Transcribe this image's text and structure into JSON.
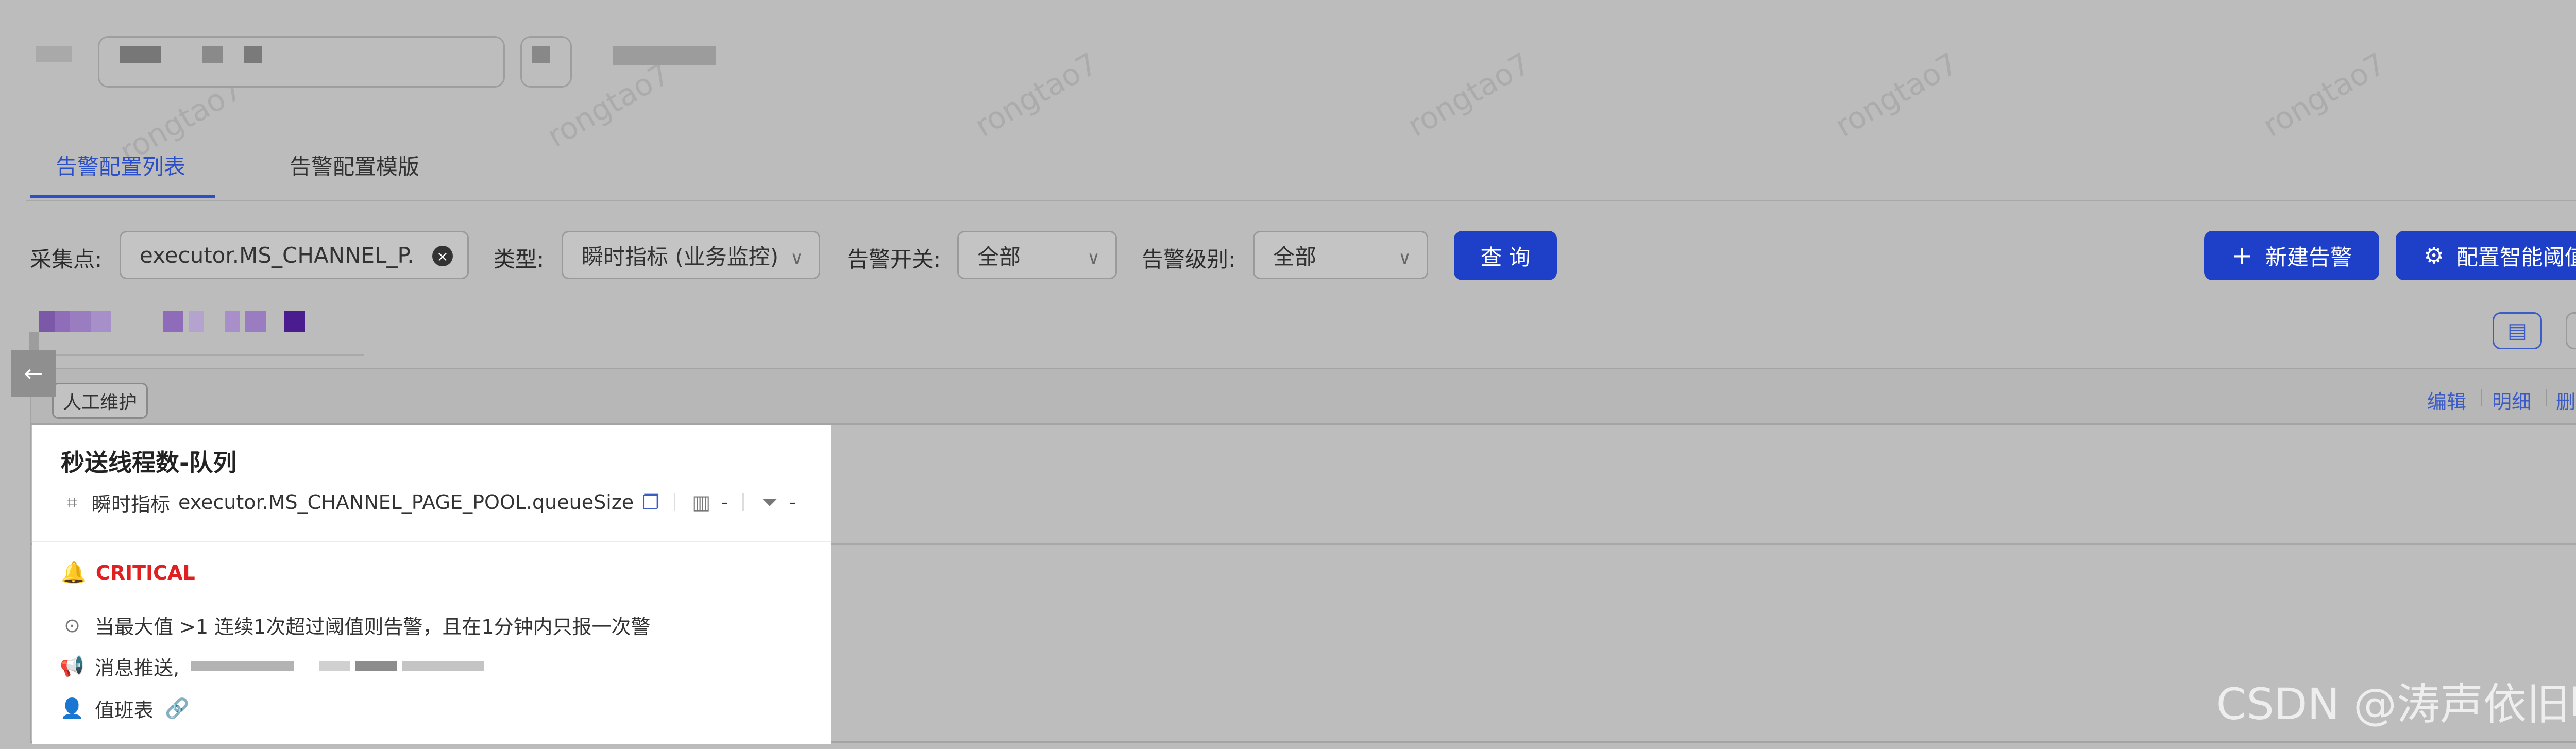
{
  "header": {
    "breadcrumb_blocks": [
      "",
      "",
      "",
      ""
    ]
  },
  "tabs": [
    {
      "label": "告警配置列表",
      "active": true
    },
    {
      "label": "告警配置模版",
      "active": false
    }
  ],
  "filters": {
    "collect_point": {
      "label": "采集点:",
      "value": "executor.MS_CHANNEL_P."
    },
    "type": {
      "label": "类型:",
      "value": "瞬时指标 (业务监控)"
    },
    "alarm_switch": {
      "label": "告警开关:",
      "value": "全部"
    },
    "alarm_level": {
      "label": "告警级别:",
      "value": "全部"
    },
    "query_button": "查 询"
  },
  "actions": {
    "new_alarm": "新建告警",
    "config_threshold": "配置智能阈值"
  },
  "list_header": {
    "tag": "人工维护",
    "links": [
      "编辑",
      "明细",
      "删除"
    ]
  },
  "card": {
    "title": "秒送线程数-队列",
    "metric_type": "瞬时指标",
    "metric_name": "executor.MS_CHANNEL_PAGE_POOL.queueSize",
    "field_a": "-",
    "field_b": "-",
    "level": "CRITICAL",
    "rule": "当最大值 >1 连续1次超过阈值则告警，且在1分钟内只报一次警",
    "push_label": "消息推送,",
    "duty_label": "值班表"
  },
  "watermark_text": "rongtao7",
  "footer_watermark": "CSDN @涛声依旧叭",
  "colors": {
    "primary": "#1e40c9",
    "critical": "#e02020",
    "link": "#3b5cc7",
    "overlay": "#bcbcbc"
  }
}
